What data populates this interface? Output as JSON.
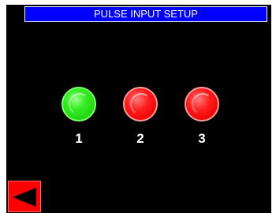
{
  "header": {
    "title": "PULSE INPUT SETUP"
  },
  "inputs": [
    {
      "label": "1",
      "state": "on",
      "color": "#22ee11"
    },
    {
      "label": "2",
      "state": "off",
      "color": "#ff1010"
    },
    {
      "label": "3",
      "state": "off",
      "color": "#ff1010"
    }
  ],
  "navigation": {
    "back_icon": "left-arrow-icon",
    "back_color": "#ff0000",
    "arrow_color": "#000000"
  },
  "colors": {
    "background": "#000000",
    "title_bar": "#0000ff",
    "text": "#ffffff"
  }
}
